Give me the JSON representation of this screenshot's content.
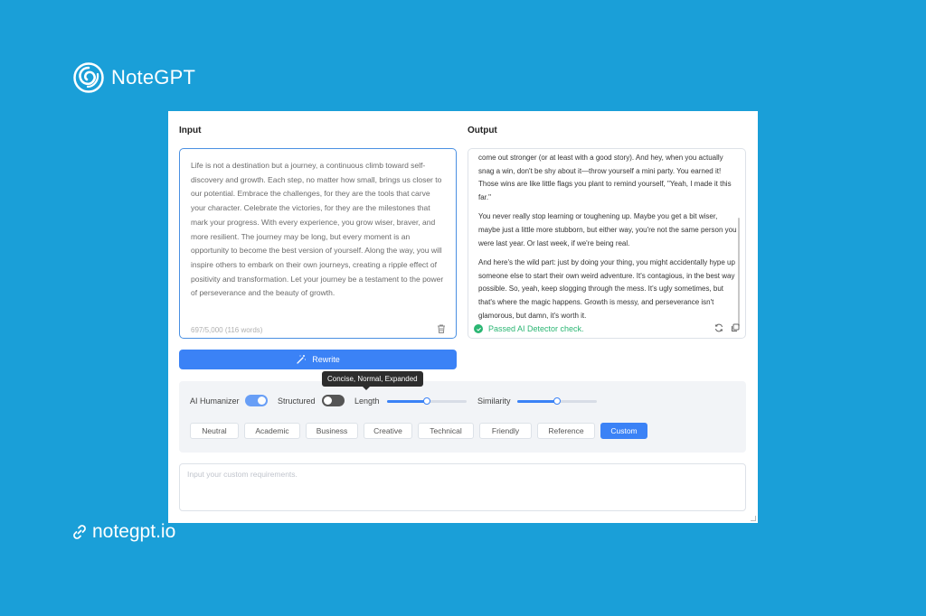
{
  "brand": {
    "name": "NoteGPT",
    "logo_icon": "swirl-logo-icon"
  },
  "site": {
    "url_text": "notegpt.io",
    "icon": "link-icon"
  },
  "input": {
    "title": "Input",
    "text": "Life is not a destination but a journey, a continuous climb toward self-discovery and growth. Each step, no matter how small, brings us closer to our potential. Embrace the challenges, for they are the tools that carve your character. Celebrate the victories, for they are the milestones that mark your progress. With every experience, you grow wiser, braver, and more resilient. The journey may be long, but every moment is an opportunity to become the best version of yourself. Along the way, you will inspire others to embark on their own journeys, creating a ripple effect of positivity and transformation. Let your journey be a testament to the power of perseverance and the beauty of growth.",
    "char_count": "697/5,000 (116 words)"
  },
  "output": {
    "title": "Output",
    "paragraphs": [
      "come out stronger (or at least with a good story). And hey, when you actually snag a win, don't be shy about it—throw yourself a mini party. You earned it! Those wins are like little flags you plant to remind yourself, \"Yeah, I made it this far.\"",
      "You never really stop learning or toughening up. Maybe you get a bit wiser, maybe just a little more stubborn, but either way, you're not the same person you were last year. Or last week, if we're being real.",
      "And here's the wild part: just by doing your thing, you might accidentally hype up someone else to start their own weird adventure. It's contagious, in the best way possible. So, yeah, keep slogging through the mess. It's ugly sometimes, but that's where the magic happens. Growth is messy, and perseverance isn't glamorous, but damn, it's worth it."
    ],
    "status": "Passed AI Detector check."
  },
  "rewrite": {
    "label": "Rewrite"
  },
  "tooltip": "Concise, Normal, Expanded",
  "settings": {
    "ai_humanizer": {
      "label": "AI Humanizer",
      "on": true
    },
    "structured": {
      "label": "Structured",
      "on": false
    },
    "length": {
      "label": "Length",
      "value": 0.5
    },
    "similarity": {
      "label": "Similarity",
      "value": 0.5
    }
  },
  "modes": [
    "Neutral",
    "Academic",
    "Business",
    "Creative",
    "Technical",
    "Friendly",
    "Reference",
    "Custom"
  ],
  "active_mode": "Custom",
  "custom": {
    "placeholder": "Input your custom requirements."
  },
  "colors": {
    "background": "#1a9fd8",
    "accent": "#3b82f6",
    "success": "#2bb673"
  }
}
